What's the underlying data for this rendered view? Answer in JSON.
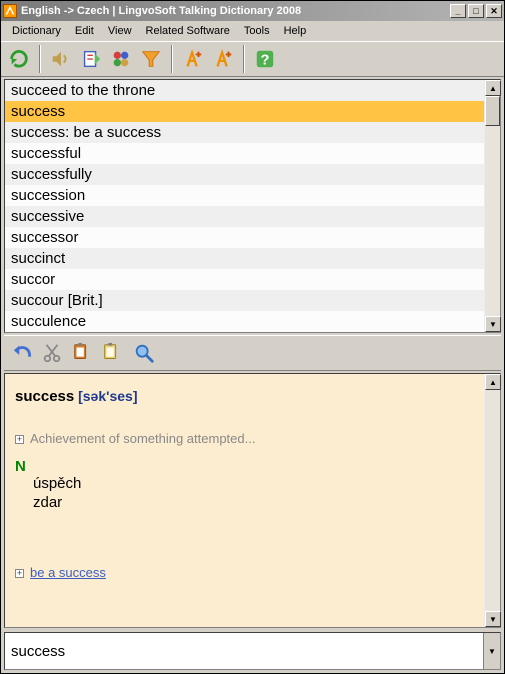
{
  "window": {
    "title": "English -> Czech | LingvoSoft Talking Dictionary 2008"
  },
  "menu": {
    "items": [
      "Dictionary",
      "Edit",
      "View",
      "Related Software",
      "Tools",
      "Help"
    ]
  },
  "toolbar1": {
    "icons": [
      "refresh",
      "speaker",
      "clipboard",
      "shapes",
      "funnel",
      "font-up",
      "font-down",
      "help"
    ]
  },
  "wordlist": {
    "items": [
      {
        "text": "succeed to the throne",
        "selected": false
      },
      {
        "text": "success",
        "selected": true
      },
      {
        "text": "success: be a success",
        "selected": false
      },
      {
        "text": "successful",
        "selected": false
      },
      {
        "text": "successfully",
        "selected": false
      },
      {
        "text": "succession",
        "selected": false
      },
      {
        "text": "successive",
        "selected": false
      },
      {
        "text": "successor",
        "selected": false
      },
      {
        "text": "succinct",
        "selected": false
      },
      {
        "text": "succor",
        "selected": false
      },
      {
        "text": "succour [Brit.]",
        "selected": false
      },
      {
        "text": "succulence",
        "selected": false
      }
    ]
  },
  "toolbar2": {
    "icons": [
      "undo",
      "cut",
      "copy",
      "paste",
      "magnify"
    ]
  },
  "detail": {
    "headword": "success",
    "phonetic": "[sək'ses]",
    "definition": "Achievement of something attempted...",
    "pos": "N",
    "translations": [
      "úspěch",
      "zdar"
    ],
    "related": "be a success"
  },
  "search": {
    "value": "success"
  },
  "glyphs": {
    "min": "_",
    "max": "□",
    "close": "✕",
    "up": "▲",
    "down": "▼",
    "plus": "+"
  }
}
